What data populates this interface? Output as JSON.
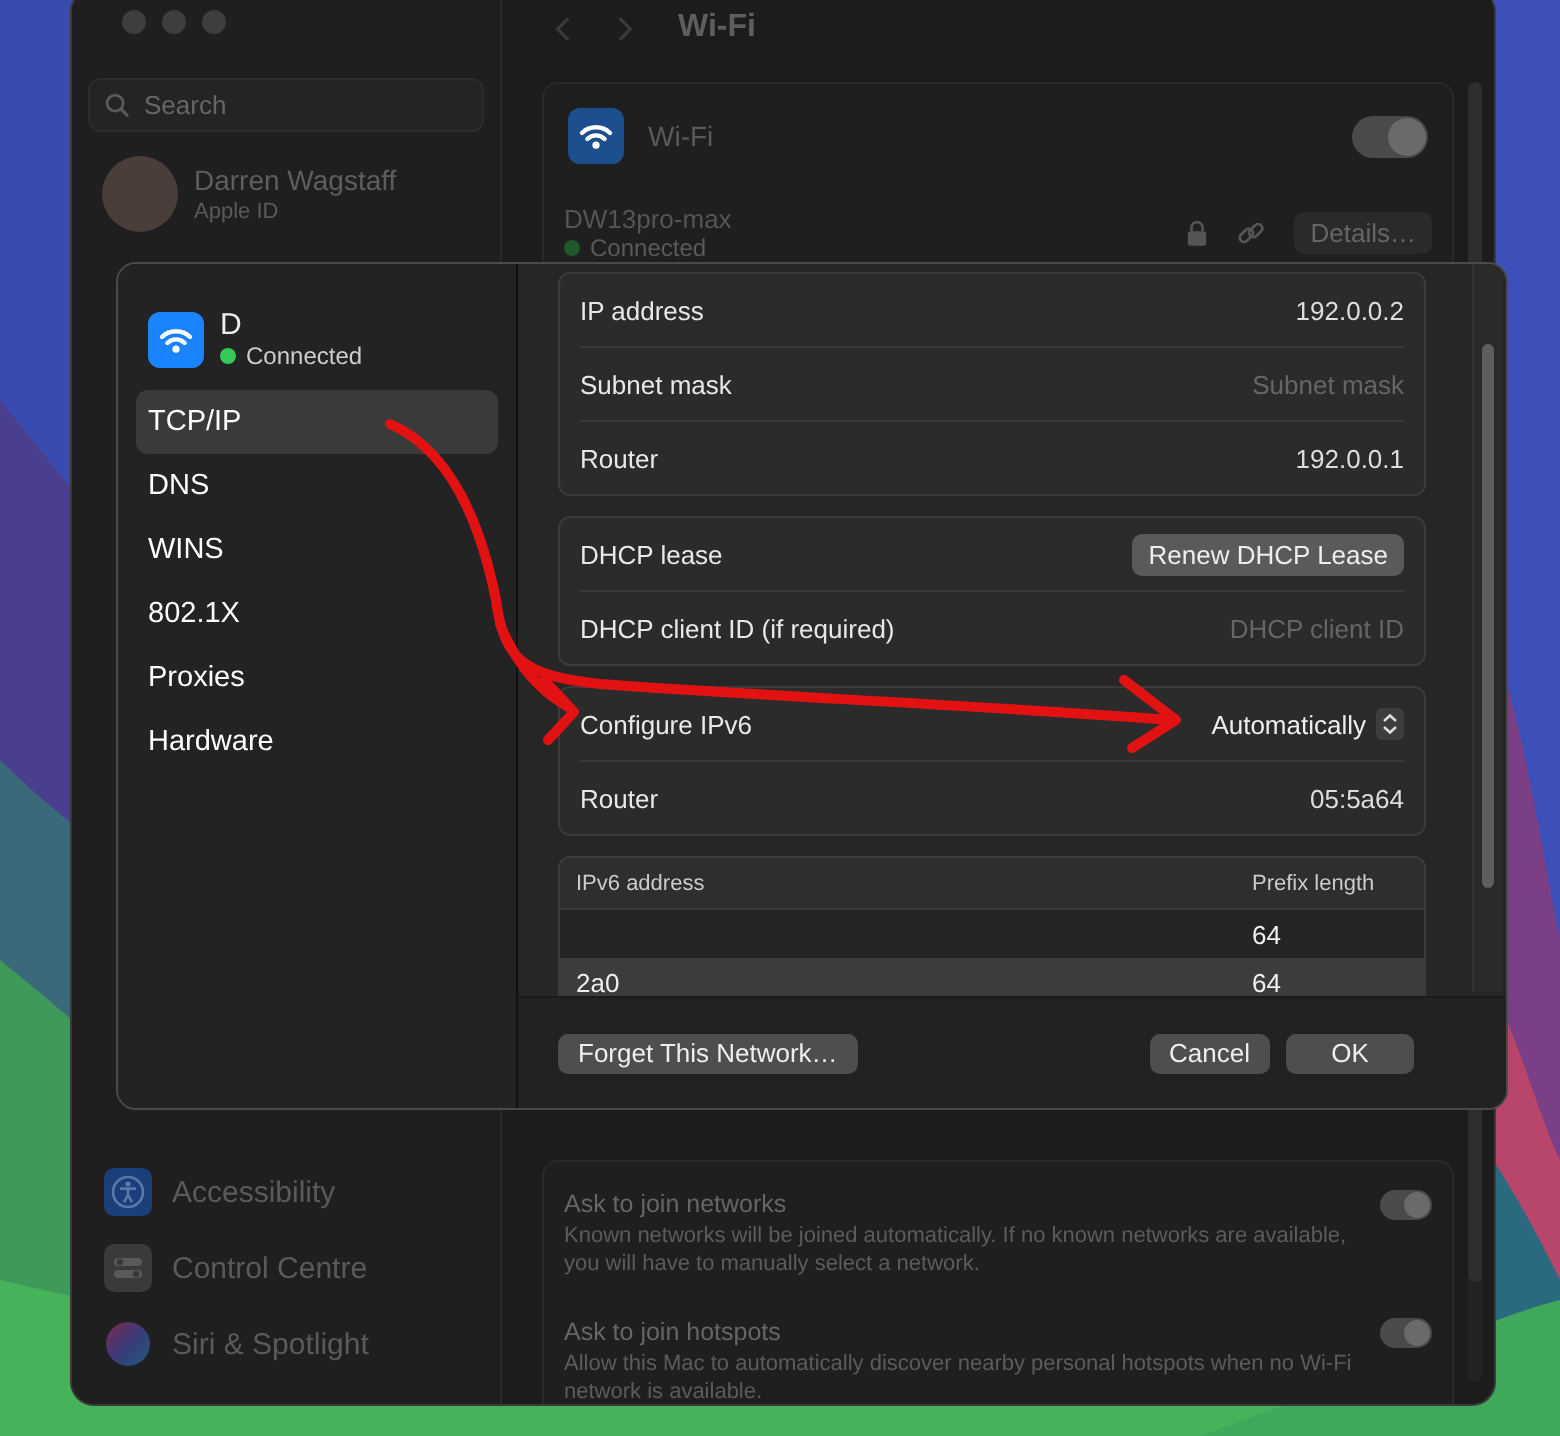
{
  "settings_window": {
    "title": "Wi-Fi",
    "search": {
      "placeholder": "Search"
    },
    "account": {
      "name": "Darren Wagstaff",
      "subtitle": "Apple ID"
    },
    "sidebar_items": [
      {
        "label": "Accessibility",
        "kind": "accessibility"
      },
      {
        "label": "Control Centre",
        "kind": "control"
      },
      {
        "label": "Siri & Spotlight",
        "kind": "siri"
      }
    ],
    "wifi": {
      "label": "Wi-Fi",
      "on": true
    },
    "network": {
      "name": "DW13pro-max",
      "status": "Connected",
      "details_button": "Details…"
    },
    "options": [
      {
        "title": "Ask to join networks",
        "description": "Known networks will be joined automatically. If no known networks are available, you will have to manually select a network.",
        "on": true
      },
      {
        "title": "Ask to join hotspots",
        "description": "Allow this Mac to automatically discover nearby personal hotspots when no Wi-Fi network is available.",
        "on": true
      }
    ]
  },
  "dialog": {
    "network": {
      "name": "D",
      "status": "Connected"
    },
    "tabs": [
      {
        "label": "TCP/IP",
        "selected": true
      },
      {
        "label": "DNS",
        "selected": false
      },
      {
        "label": "WINS",
        "selected": false
      },
      {
        "label": "802.1X",
        "selected": false
      },
      {
        "label": "Proxies",
        "selected": false
      },
      {
        "label": "Hardware",
        "selected": false
      }
    ],
    "groups": [
      [
        {
          "label": "IP address",
          "value": "192.0.0.2",
          "kind": "value"
        },
        {
          "label": "Subnet mask",
          "placeholder": "Subnet mask",
          "kind": "placeholder"
        },
        {
          "label": "Router",
          "value": "192.0.0.1",
          "kind": "value"
        }
      ],
      [
        {
          "label": "DHCP lease",
          "value": "Renew DHCP Lease",
          "kind": "button"
        },
        {
          "label": "DHCP client ID (if required)",
          "placeholder": "DHCP client ID",
          "kind": "placeholder"
        }
      ],
      [
        {
          "label": "Configure IPv6",
          "value": "Automatically",
          "kind": "popup"
        },
        {
          "label": "Router",
          "value": "05:5a64",
          "kind": "value"
        }
      ]
    ],
    "ipv6_table": {
      "columns": [
        "IPv6 address",
        "Prefix length"
      ],
      "rows": [
        {
          "prefix": "64",
          "selected": false
        },
        {
          "address": "2a0",
          "prefix": "64",
          "selected": true
        }
      ]
    },
    "buttons": {
      "forget": "Forget This Network…",
      "cancel": "Cancel",
      "ok": "OK"
    }
  }
}
